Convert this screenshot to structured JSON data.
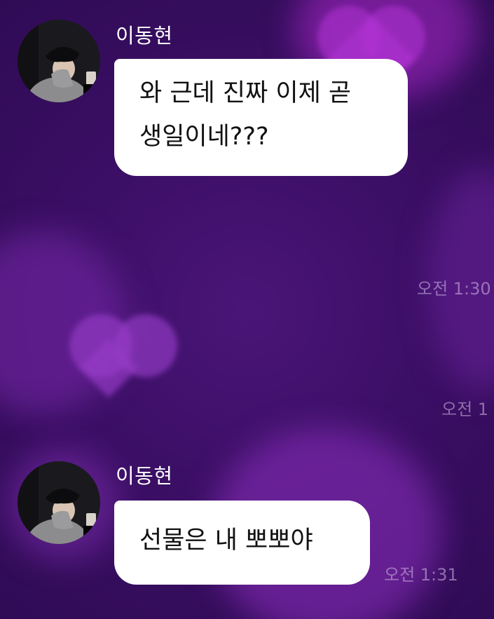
{
  "colors": {
    "background": "#3b0f63",
    "bubble": "#ffffff",
    "bubble_text": "#111111",
    "sender_text": "#ffffff",
    "time_text": "#c8b4dc"
  },
  "messages": [
    {
      "sender": "이동현",
      "avatar_icon": "profile-photo",
      "lines": [
        "와 근데 진짜 이제 곧",
        "생일이네???"
      ]
    },
    {
      "sender": "이동현",
      "avatar_icon": "profile-photo",
      "lines": [
        "선물은 내 뽀뽀야"
      ],
      "time": "오전 1:31"
    }
  ],
  "timestamps": [
    "오전 1:30",
    "오전 1"
  ]
}
